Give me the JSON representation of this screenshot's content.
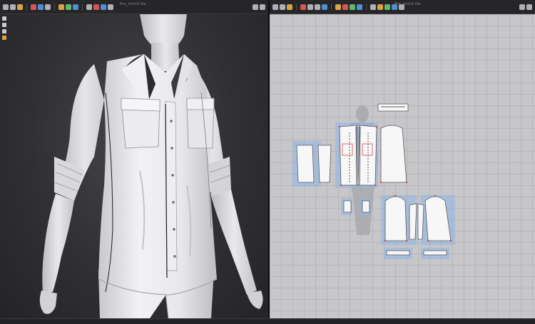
{
  "app": {
    "left_window_title": "Pro_shirt3.file",
    "right_window_title": "Pro_shirt3.file"
  },
  "icons": {
    "left_toolbar": [
      "select-icon",
      "move-icon",
      "rotate-icon",
      "scale-icon",
      "sew-icon",
      "pin-icon",
      "fold-icon",
      "brush-icon",
      "simulate-icon",
      "tape-icon",
      "avatar-icon",
      "measure-icon",
      "camera-icon"
    ],
    "right_toolbar": [
      "transform-icon",
      "edit-point-icon",
      "curve-icon",
      "polygon-icon",
      "rectangle-icon",
      "circle-icon",
      "internal-line-icon",
      "dart-icon",
      "notch-icon",
      "segment-sew-icon",
      "free-sew-icon",
      "trim-icon",
      "pleat-icon",
      "pattern-icon",
      "layout-icon",
      "texture-icon"
    ],
    "side_tools": [
      "display-icon",
      "view-icon",
      "light-icon",
      "avatar-toggle-icon"
    ]
  },
  "colors": {
    "viewport_bg": "#303033",
    "pattern_bg": "#c7c7c9",
    "grid_line": "#b7b7ba",
    "pattern_piece_fill": "#f7f7f8",
    "selection_highlight": "#8fb6e8",
    "shirt_dark_inner": "#2c2c30",
    "accent_point": "#d94a4a"
  }
}
